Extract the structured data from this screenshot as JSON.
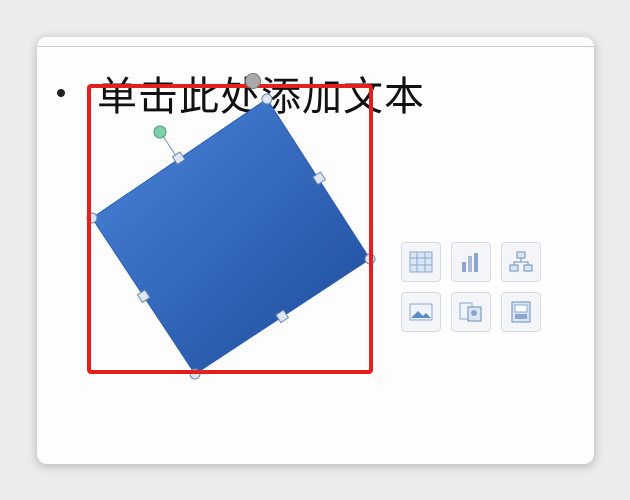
{
  "slide": {
    "placeholder_text": "单击此处添加文本",
    "bullet_char": "•"
  },
  "colors": {
    "selection_outline": "#e51e1e",
    "shape_fill_light": "#3f7dd6",
    "shape_fill_dark": "#1f4fa3",
    "handle_green": "#7fd0a8"
  },
  "content_icons": [
    {
      "name": "insert-table-icon"
    },
    {
      "name": "insert-chart-icon"
    },
    {
      "name": "insert-smartart-icon"
    },
    {
      "name": "insert-picture-icon"
    },
    {
      "name": "insert-clipart-icon"
    },
    {
      "name": "insert-media-icon"
    }
  ]
}
